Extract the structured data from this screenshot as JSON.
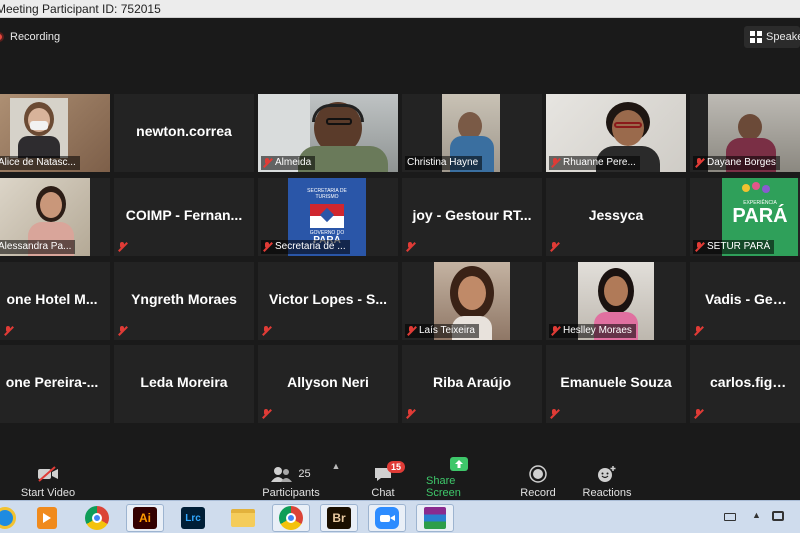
{
  "window": {
    "title": "Meeting Participant ID: 752015"
  },
  "recording": {
    "label": "Recording"
  },
  "view": {
    "label": "Speaker View"
  },
  "tiles": [
    {
      "name": "Beatriz Alice de Natascha",
      "label": "Alice de Natasc...",
      "video": true,
      "muted": false
    },
    {
      "name": "newton.correa",
      "label": "",
      "video": false,
      "muted": false
    },
    {
      "name": "Almeida",
      "label": "Almeida",
      "video": true,
      "muted": true
    },
    {
      "name": "Christina Hayne",
      "label": "Christina Hayne",
      "video": true,
      "muted": false
    },
    {
      "name": "Rhuanne Pereira",
      "label": "Rhuanne Pere...",
      "video": true,
      "muted": true
    },
    {
      "name": "Dayane Borges",
      "label": "Dayane Borges",
      "video": true,
      "muted": true
    },
    {
      "name": "Alessandra Pa...",
      "label": "Alessandra Pa...",
      "video": true,
      "muted": false
    },
    {
      "name": "COIMP - Fernan...",
      "label": "",
      "video": false,
      "muted": true
    },
    {
      "name": "Secretaria de ...",
      "label": "Secretaria de ...",
      "video": true,
      "muted": true
    },
    {
      "name": "joy - Gestour RT...",
      "label": "",
      "video": false,
      "muted": true
    },
    {
      "name": "Jessyca",
      "label": "",
      "video": false,
      "muted": true
    },
    {
      "name": "SETUR PARÁ",
      "label": "SETUR PARÁ",
      "video": true,
      "muted": true
    },
    {
      "name": "one Hotel M...",
      "label": "",
      "video": false,
      "muted": true
    },
    {
      "name": "Yngreth Moraes",
      "label": "",
      "video": false,
      "muted": true
    },
    {
      "name": "Victor Lopes - S...",
      "label": "",
      "video": false,
      "muted": true
    },
    {
      "name": "Laís Teixeira",
      "label": "Laís Teixeira",
      "video": true,
      "muted": true
    },
    {
      "name": "Heslley Moraes",
      "label": "Heslley Moraes",
      "video": true,
      "muted": true
    },
    {
      "name": "Vadis - Gesto...",
      "label": "",
      "video": false,
      "muted": true
    },
    {
      "name": "one Pereira-...",
      "label": "",
      "video": false,
      "muted": false
    },
    {
      "name": "Leda Moreira",
      "label": "",
      "video": false,
      "muted": false
    },
    {
      "name": "Allyson Neri",
      "label": "",
      "video": false,
      "muted": true
    },
    {
      "name": "Riba Araújo",
      "label": "",
      "video": false,
      "muted": true
    },
    {
      "name": "Emanuele Souza",
      "label": "",
      "video": false,
      "muted": true
    },
    {
      "name": "carlos.figueir...",
      "label": "",
      "video": false,
      "muted": true
    }
  ],
  "logo_texts": {
    "secretaria_line1": "SECRETARIA DE",
    "secretaria_line2": "TURISMO",
    "secretaria_line3": "GOVERNO DO",
    "secretaria_line4": "PARÁ",
    "setur_small": "EXPERIÊNCIA",
    "setur_big": "PARÁ"
  },
  "toolbar": {
    "start_video": "Start Video",
    "participants": "Participants",
    "participants_count": "25",
    "chat": "Chat",
    "chat_badge": "15",
    "share_screen": "Share Screen",
    "record": "Record",
    "reactions": "Reactions"
  },
  "taskbar": {
    "apps": [
      "ie-icon",
      "media-player-icon",
      "chrome-icon",
      "illustrator-icon",
      "lightroom-icon",
      "explorer-icon",
      "chrome-icon",
      "bridge-icon",
      "zoom-icon",
      "winrar-icon"
    ],
    "illustrator_text": "Ai",
    "lightroom_text": "Lrc",
    "bridge_text": "Br"
  },
  "colors": {
    "active_speaker": "#c8e05a",
    "share_green": "#3ec76a",
    "muted_red": "#e03b36"
  }
}
